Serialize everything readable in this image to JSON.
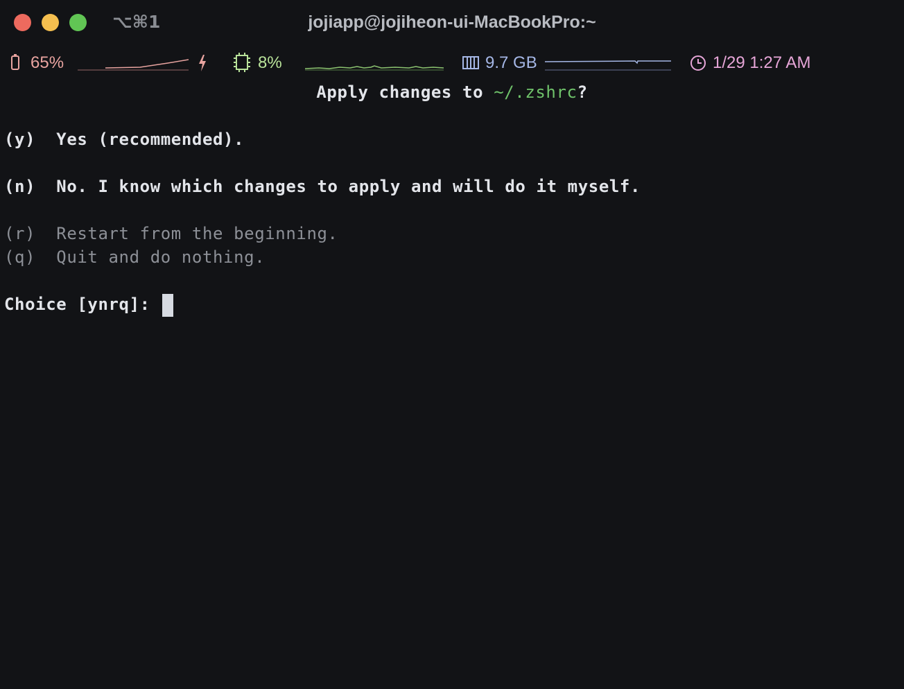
{
  "window": {
    "title": "jojiapp@jojiheon-ui-MacBookPro:~",
    "shortcut": "⌥⌘1"
  },
  "statusbar": {
    "battery": {
      "icon": "battery-icon",
      "value": "65%",
      "charging_icon": "bolt-icon",
      "color": "#e9a4a0"
    },
    "cpu": {
      "icon": "cpu-chip-icon",
      "value": "8%",
      "color": "#b9e39a"
    },
    "memory": {
      "icon": "memory-icon",
      "value": "9.7 GB",
      "color": "#a5b7e6"
    },
    "clock": {
      "icon": "clock-icon",
      "value": "1/29 1:27 AM",
      "color": "#e7a6d8"
    }
  },
  "prompt": {
    "title_prefix": "Apply changes to ",
    "title_path": "~/.zshrc",
    "title_suffix": "?",
    "options": [
      {
        "key": "(y)",
        "label": "Yes (recommended)."
      },
      {
        "key": "(n)",
        "label": "No. I know which changes to apply and will do it myself."
      },
      {
        "key": "(r)",
        "label": "Restart from the beginning."
      },
      {
        "key": "(q)",
        "label": "Quit and do nothing."
      }
    ],
    "choice_label": "Choice [ynrq]: "
  },
  "colors": {
    "background": "#121316",
    "path_green": "#6fc26a"
  }
}
